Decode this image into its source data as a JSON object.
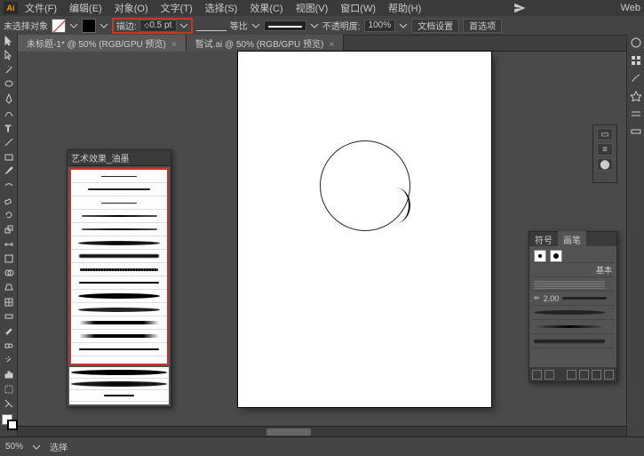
{
  "app": {
    "logo": "Ai",
    "workspace_preset": "Web"
  },
  "menu": {
    "file": "文件(F)",
    "edit": "编辑(E)",
    "object": "对象(O)",
    "type": "文字(T)",
    "select": "选择(S)",
    "effect": "效果(C)",
    "view": "视图(V)",
    "window": "窗口(W)",
    "help": "帮助(H)"
  },
  "optbar": {
    "no_selection": "未选择对象",
    "stroke_label": "描边:",
    "stroke_weight": "0.5 pt",
    "uniform": "等比",
    "opacity_label": "不透明度:",
    "opacity_value": "100%",
    "doc_setup": "文档设置",
    "preferences": "首选项"
  },
  "tabs": [
    {
      "label": "未标题-1* @ 50% (RGB/GPU 预览)",
      "active": true
    },
    {
      "label": "暂试.ai @ 50% (RGB/GPU 预览)",
      "active": false
    }
  ],
  "brushes_panel": {
    "title": "艺术效果_油墨"
  },
  "brushes_panel2": {
    "tab1": "符号",
    "tab2": "画笔",
    "stroke_val": "2.00",
    "basic": "基本"
  },
  "status": {
    "zoom": "50%",
    "tool": "选择"
  }
}
